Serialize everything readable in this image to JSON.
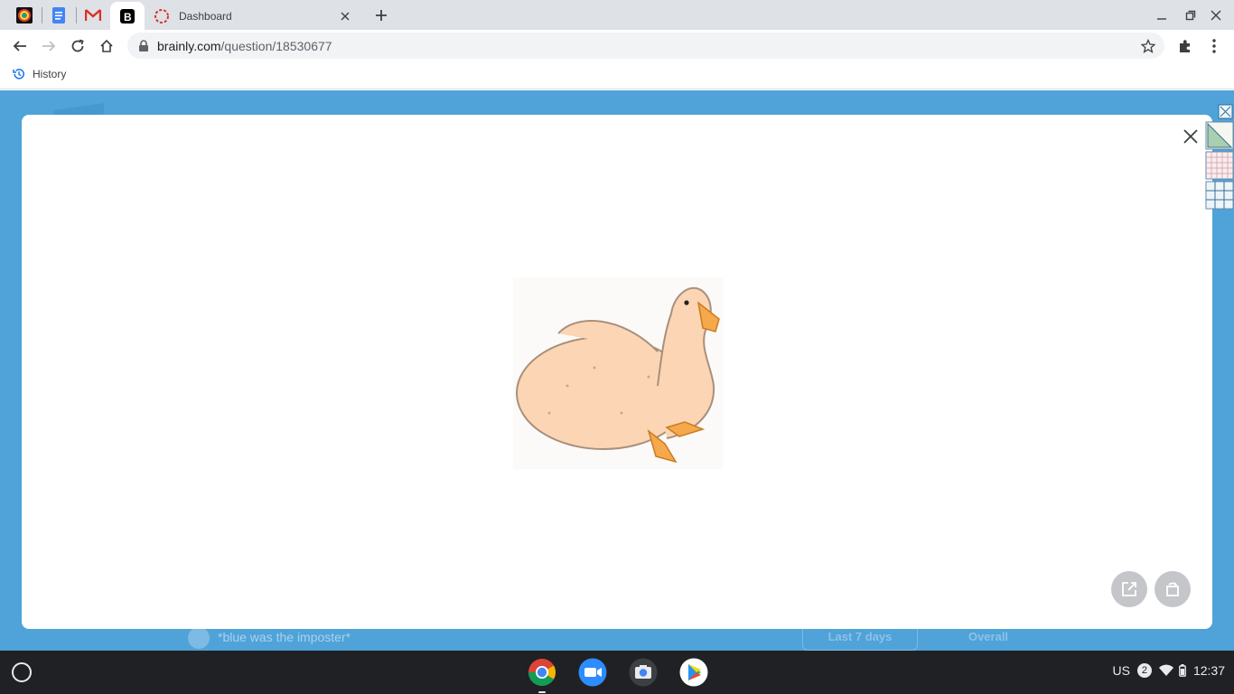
{
  "browser": {
    "tabs": [
      {
        "name": "Colorful app",
        "pinned": true
      },
      {
        "name": "Google Docs",
        "pinned": true
      },
      {
        "name": "Gmail",
        "pinned": true
      },
      {
        "name": "Brainly",
        "pinned": true,
        "active": true
      },
      {
        "name": "Dashboard",
        "pinned": false,
        "title": "Dashboard"
      }
    ],
    "address": {
      "domain": "brainly.com",
      "path": "/question/18530677"
    },
    "bookmarks": [
      {
        "label": "History",
        "icon": "history-icon"
      }
    ]
  },
  "page": {
    "background_color": "#4fa3d8",
    "behind_modal": {
      "comment_text": "*blue was the imposter*",
      "filter_last7": "Last 7 days",
      "filter_overall": "Overall"
    },
    "modal": {
      "image_subject": "duck-illustration",
      "buttons": [
        "open-in-new-icon",
        "rotate-image-icon"
      ]
    }
  },
  "shelf": {
    "apps": [
      "chrome-icon",
      "zoom-icon",
      "camera-icon",
      "play-store-icon"
    ],
    "tray": {
      "locale": "US",
      "notifications": "2",
      "time": "12:37"
    }
  },
  "colors": {
    "accent": "#1a73e8",
    "tabstrip": "#dee1e6",
    "shelf": "#202124"
  }
}
